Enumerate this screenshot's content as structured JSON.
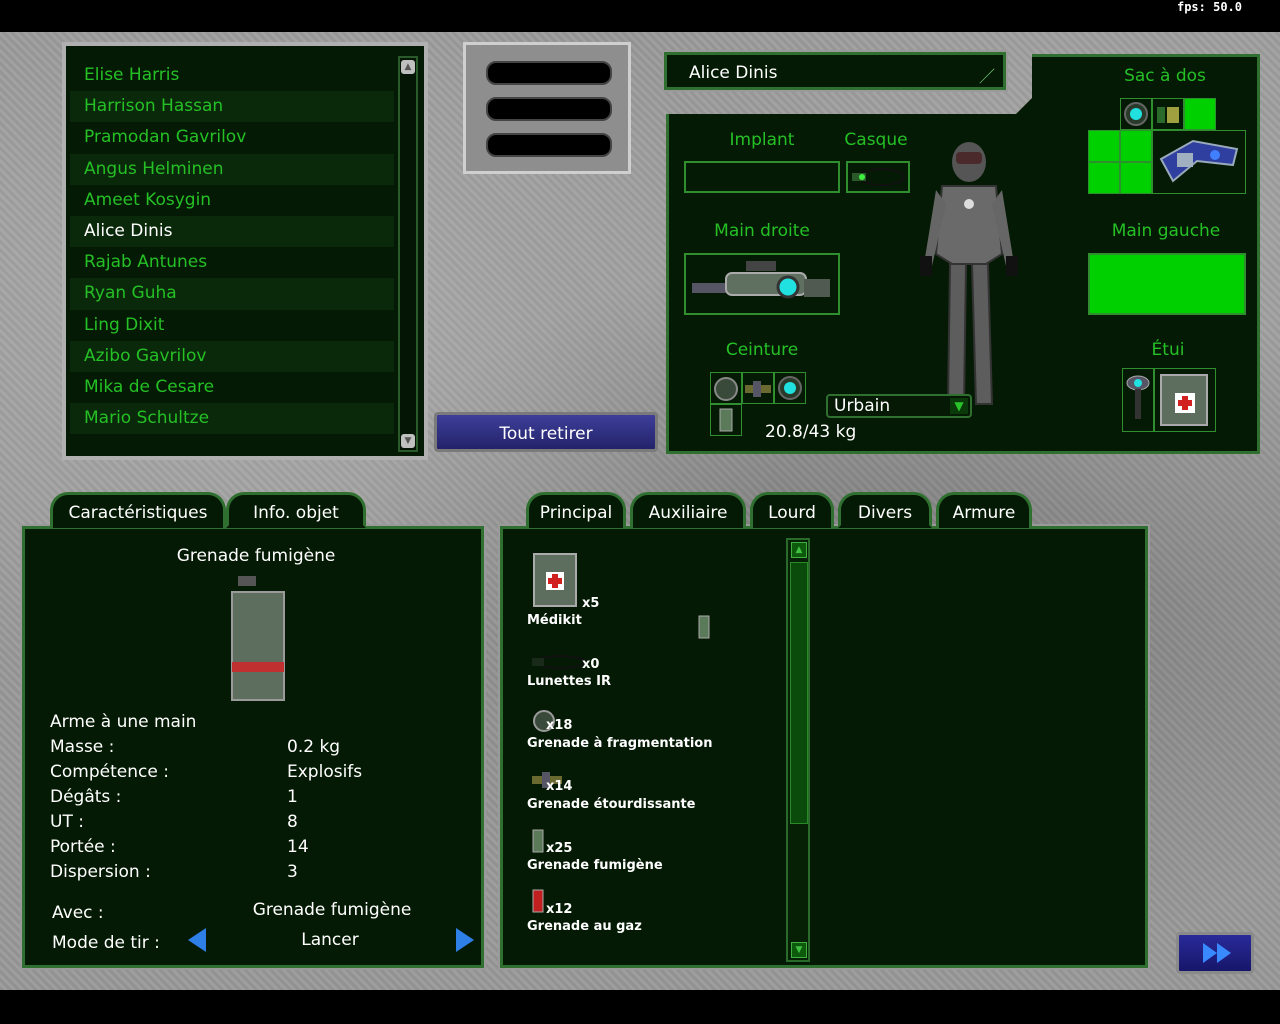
{
  "fps_label": "fps: 50.0",
  "soldiers": [
    {
      "name": "Elise Harris",
      "selected": false
    },
    {
      "name": "Harrison Hassan",
      "selected": false
    },
    {
      "name": "Pramodan Gavrilov",
      "selected": false
    },
    {
      "name": "Angus Helminen",
      "selected": false
    },
    {
      "name": "Ameet Kosygin",
      "selected": false
    },
    {
      "name": "Alice Dinis",
      "selected": true
    },
    {
      "name": "Rajab Antunes",
      "selected": false
    },
    {
      "name": "Ryan Guha",
      "selected": false
    },
    {
      "name": "Ling Dixit",
      "selected": false
    },
    {
      "name": "Azibo Gavrilov",
      "selected": false
    },
    {
      "name": "Mika de Cesare",
      "selected": false
    },
    {
      "name": "Mario Schultze",
      "selected": false
    }
  ],
  "actions": {
    "remove_all": "Tout retirer"
  },
  "soldier": {
    "name": "Alice Dinis",
    "weight": "20.8/43 kg",
    "camo": "Urbain"
  },
  "equipment_labels": {
    "implant": "Implant",
    "helmet": "Casque",
    "backpack": "Sac à dos",
    "right_hand": "Main droite",
    "left_hand": "Main gauche",
    "belt": "Ceinture",
    "holster": "Étui"
  },
  "left_tabs": [
    "Caractéristiques",
    "Info. objet"
  ],
  "item_info": {
    "title": "Grenade fumigène",
    "type": "Arme à une main",
    "stats": [
      {
        "label": "Masse :",
        "value": "0.2 kg"
      },
      {
        "label": "Compétence :",
        "value": "Explosifs"
      },
      {
        "label": "Dégâts :",
        "value": "1"
      },
      {
        "label": "UT :",
        "value": "8"
      },
      {
        "label": "Portée :",
        "value": "14"
      },
      {
        "label": "Dispersion :",
        "value": "3"
      }
    ],
    "with_label": "Avec :",
    "with_value": "Grenade fumigène",
    "fire_mode_label": "Mode de tir :",
    "fire_mode_value": "Lancer"
  },
  "inventory_tabs": [
    "Principal",
    "Auxiliaire",
    "Lourd",
    "Divers",
    "Armure"
  ],
  "active_inventory_tab": "Divers",
  "inventory": [
    {
      "name": "Médikit",
      "count": "x5",
      "icon": "medikit-icon"
    },
    {
      "name": "Lunettes IR",
      "count": "x0",
      "icon": "ir-goggles-icon"
    },
    {
      "name": "Grenade à fragmentation",
      "count": "x18",
      "icon": "frag-grenade-icon"
    },
    {
      "name": "Grenade étourdissante",
      "count": "x14",
      "icon": "stun-grenade-icon"
    },
    {
      "name": "Grenade fumigène",
      "count": "x25",
      "icon": "smoke-grenade-icon"
    },
    {
      "name": "Grenade au gaz",
      "count": "x12",
      "icon": "gas-grenade-icon"
    }
  ],
  "colors": {
    "accent_green": "#25c025",
    "panel_bg": "#041a04",
    "button_blue": "#2e2e8a"
  }
}
